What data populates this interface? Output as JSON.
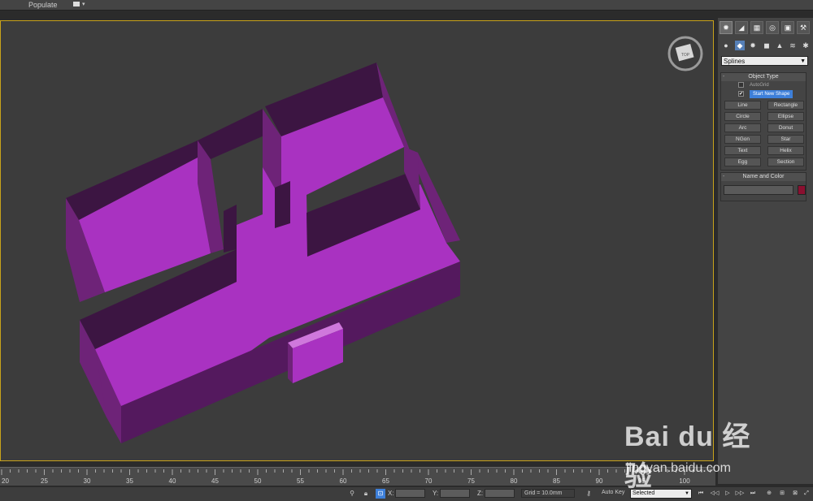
{
  "toolbar": {
    "menu_label": "Populate",
    "caret": "▾"
  },
  "viewcube": {
    "face_label": "TOP"
  },
  "command_panel": {
    "tabs": [
      "✹",
      "◢",
      "▦",
      "◎",
      "▣",
      "⚒"
    ],
    "categories": [
      "●",
      "◆",
      "✸",
      "◼",
      "▲",
      "≋",
      "✱"
    ],
    "type_dropdown": {
      "value": "Splines",
      "arrow": "▼"
    },
    "object_type": {
      "title": "Object Type",
      "autogrid_label": "AutoGrid",
      "start_new_shape_label": "Start New Shape",
      "start_new_shape_checked": true,
      "buttons": [
        "Line",
        "Rectangle",
        "Circle",
        "Ellipse",
        "Arc",
        "Donut",
        "NGon",
        "Star",
        "Text",
        "Helix",
        "Egg",
        "Section"
      ]
    },
    "name_and_color": {
      "title": "Name and Color",
      "name_value": "",
      "color": "#8a1030"
    }
  },
  "timeline": {
    "ticks": [
      "20",
      "25",
      "30",
      "35",
      "40",
      "45",
      "50",
      "55",
      "60",
      "65",
      "70",
      "75",
      "80",
      "85",
      "90",
      "95",
      "100"
    ]
  },
  "statusbar": {
    "x_label": "X:",
    "y_label": "Y:",
    "z_label": "Z:",
    "grid_text": "Grid = 10.0mm",
    "auto_key_label": "Auto Key",
    "selection_value": "Selected",
    "selection_arrow": "▼",
    "playback": [
      "⏮",
      "◁◁",
      "▷",
      "▷▷",
      "⏭"
    ]
  },
  "watermark": {
    "logo_text": "Bai du 经验",
    "url_text": "jingyan.baidu.com"
  },
  "colors": {
    "floor": "#a932c1",
    "wall_dark": "#3c1542",
    "wall_side": "#6e2378",
    "wall_mid": "#54195e",
    "step_light": "#cf78dc",
    "selection_accent": "#3d7fd9",
    "viewport_border": "#c9a31a"
  }
}
